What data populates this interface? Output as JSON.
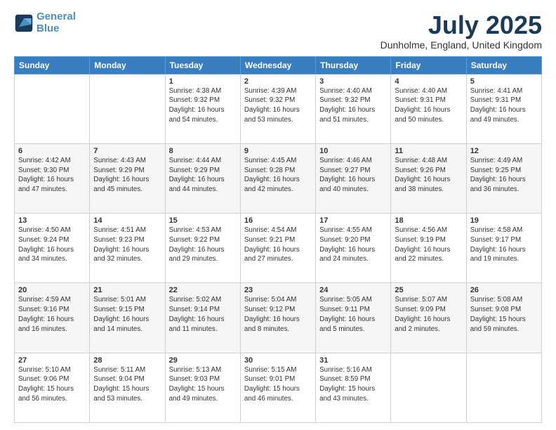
{
  "logo": {
    "line1": "General",
    "line2": "Blue"
  },
  "header": {
    "title": "July 2025",
    "location": "Dunholme, England, United Kingdom"
  },
  "weekdays": [
    "Sunday",
    "Monday",
    "Tuesday",
    "Wednesday",
    "Thursday",
    "Friday",
    "Saturday"
  ],
  "weeks": [
    [
      {
        "day": "",
        "sunrise": "",
        "sunset": "",
        "daylight": ""
      },
      {
        "day": "",
        "sunrise": "",
        "sunset": "",
        "daylight": ""
      },
      {
        "day": "1",
        "sunrise": "Sunrise: 4:38 AM",
        "sunset": "Sunset: 9:32 PM",
        "daylight": "Daylight: 16 hours and 54 minutes."
      },
      {
        "day": "2",
        "sunrise": "Sunrise: 4:39 AM",
        "sunset": "Sunset: 9:32 PM",
        "daylight": "Daylight: 16 hours and 53 minutes."
      },
      {
        "day": "3",
        "sunrise": "Sunrise: 4:40 AM",
        "sunset": "Sunset: 9:32 PM",
        "daylight": "Daylight: 16 hours and 51 minutes."
      },
      {
        "day": "4",
        "sunrise": "Sunrise: 4:40 AM",
        "sunset": "Sunset: 9:31 PM",
        "daylight": "Daylight: 16 hours and 50 minutes."
      },
      {
        "day": "5",
        "sunrise": "Sunrise: 4:41 AM",
        "sunset": "Sunset: 9:31 PM",
        "daylight": "Daylight: 16 hours and 49 minutes."
      }
    ],
    [
      {
        "day": "6",
        "sunrise": "Sunrise: 4:42 AM",
        "sunset": "Sunset: 9:30 PM",
        "daylight": "Daylight: 16 hours and 47 minutes."
      },
      {
        "day": "7",
        "sunrise": "Sunrise: 4:43 AM",
        "sunset": "Sunset: 9:29 PM",
        "daylight": "Daylight: 16 hours and 45 minutes."
      },
      {
        "day": "8",
        "sunrise": "Sunrise: 4:44 AM",
        "sunset": "Sunset: 9:29 PM",
        "daylight": "Daylight: 16 hours and 44 minutes."
      },
      {
        "day": "9",
        "sunrise": "Sunrise: 4:45 AM",
        "sunset": "Sunset: 9:28 PM",
        "daylight": "Daylight: 16 hours and 42 minutes."
      },
      {
        "day": "10",
        "sunrise": "Sunrise: 4:46 AM",
        "sunset": "Sunset: 9:27 PM",
        "daylight": "Daylight: 16 hours and 40 minutes."
      },
      {
        "day": "11",
        "sunrise": "Sunrise: 4:48 AM",
        "sunset": "Sunset: 9:26 PM",
        "daylight": "Daylight: 16 hours and 38 minutes."
      },
      {
        "day": "12",
        "sunrise": "Sunrise: 4:49 AM",
        "sunset": "Sunset: 9:25 PM",
        "daylight": "Daylight: 16 hours and 36 minutes."
      }
    ],
    [
      {
        "day": "13",
        "sunrise": "Sunrise: 4:50 AM",
        "sunset": "Sunset: 9:24 PM",
        "daylight": "Daylight: 16 hours and 34 minutes."
      },
      {
        "day": "14",
        "sunrise": "Sunrise: 4:51 AM",
        "sunset": "Sunset: 9:23 PM",
        "daylight": "Daylight: 16 hours and 32 minutes."
      },
      {
        "day": "15",
        "sunrise": "Sunrise: 4:53 AM",
        "sunset": "Sunset: 9:22 PM",
        "daylight": "Daylight: 16 hours and 29 minutes."
      },
      {
        "day": "16",
        "sunrise": "Sunrise: 4:54 AM",
        "sunset": "Sunset: 9:21 PM",
        "daylight": "Daylight: 16 hours and 27 minutes."
      },
      {
        "day": "17",
        "sunrise": "Sunrise: 4:55 AM",
        "sunset": "Sunset: 9:20 PM",
        "daylight": "Daylight: 16 hours and 24 minutes."
      },
      {
        "day": "18",
        "sunrise": "Sunrise: 4:56 AM",
        "sunset": "Sunset: 9:19 PM",
        "daylight": "Daylight: 16 hours and 22 minutes."
      },
      {
        "day": "19",
        "sunrise": "Sunrise: 4:58 AM",
        "sunset": "Sunset: 9:17 PM",
        "daylight": "Daylight: 16 hours and 19 minutes."
      }
    ],
    [
      {
        "day": "20",
        "sunrise": "Sunrise: 4:59 AM",
        "sunset": "Sunset: 9:16 PM",
        "daylight": "Daylight: 16 hours and 16 minutes."
      },
      {
        "day": "21",
        "sunrise": "Sunrise: 5:01 AM",
        "sunset": "Sunset: 9:15 PM",
        "daylight": "Daylight: 16 hours and 14 minutes."
      },
      {
        "day": "22",
        "sunrise": "Sunrise: 5:02 AM",
        "sunset": "Sunset: 9:14 PM",
        "daylight": "Daylight: 16 hours and 11 minutes."
      },
      {
        "day": "23",
        "sunrise": "Sunrise: 5:04 AM",
        "sunset": "Sunset: 9:12 PM",
        "daylight": "Daylight: 16 hours and 8 minutes."
      },
      {
        "day": "24",
        "sunrise": "Sunrise: 5:05 AM",
        "sunset": "Sunset: 9:11 PM",
        "daylight": "Daylight: 16 hours and 5 minutes."
      },
      {
        "day": "25",
        "sunrise": "Sunrise: 5:07 AM",
        "sunset": "Sunset: 9:09 PM",
        "daylight": "Daylight: 16 hours and 2 minutes."
      },
      {
        "day": "26",
        "sunrise": "Sunrise: 5:08 AM",
        "sunset": "Sunset: 9:08 PM",
        "daylight": "Daylight: 15 hours and 59 minutes."
      }
    ],
    [
      {
        "day": "27",
        "sunrise": "Sunrise: 5:10 AM",
        "sunset": "Sunset: 9:06 PM",
        "daylight": "Daylight: 15 hours and 56 minutes."
      },
      {
        "day": "28",
        "sunrise": "Sunrise: 5:11 AM",
        "sunset": "Sunset: 9:04 PM",
        "daylight": "Daylight: 15 hours and 53 minutes."
      },
      {
        "day": "29",
        "sunrise": "Sunrise: 5:13 AM",
        "sunset": "Sunset: 9:03 PM",
        "daylight": "Daylight: 15 hours and 49 minutes."
      },
      {
        "day": "30",
        "sunrise": "Sunrise: 5:15 AM",
        "sunset": "Sunset: 9:01 PM",
        "daylight": "Daylight: 15 hours and 46 minutes."
      },
      {
        "day": "31",
        "sunrise": "Sunrise: 5:16 AM",
        "sunset": "Sunset: 8:59 PM",
        "daylight": "Daylight: 15 hours and 43 minutes."
      },
      {
        "day": "",
        "sunrise": "",
        "sunset": "",
        "daylight": ""
      },
      {
        "day": "",
        "sunrise": "",
        "sunset": "",
        "daylight": ""
      }
    ]
  ]
}
